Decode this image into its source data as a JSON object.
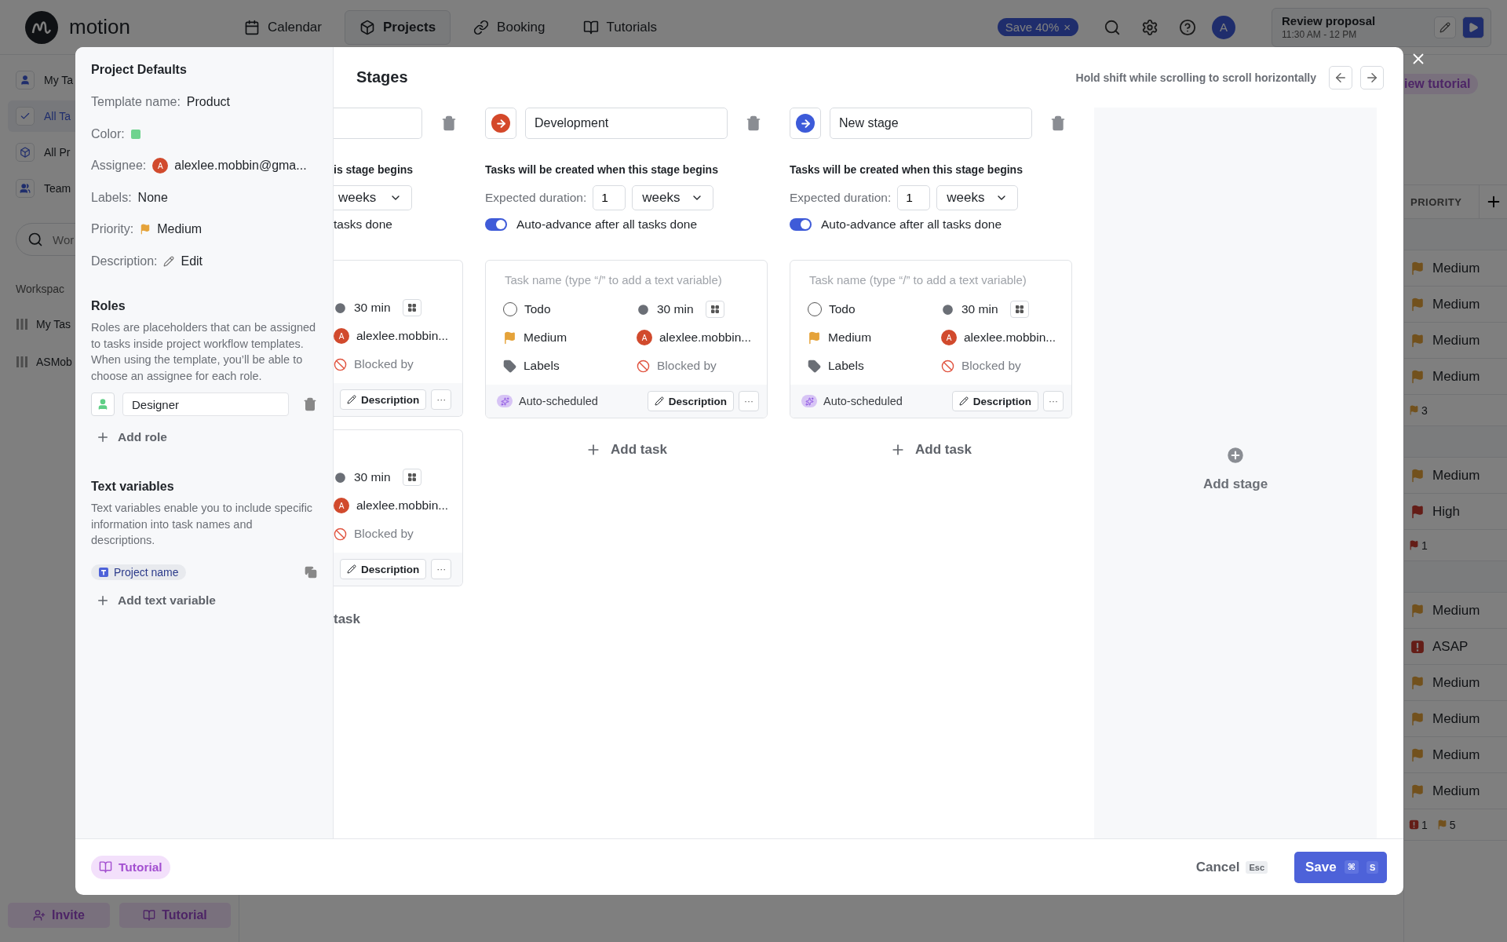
{
  "app": {
    "brand": "motion",
    "nav": [
      {
        "label": "Calendar",
        "selected": false
      },
      {
        "label": "Projects",
        "selected": true
      },
      {
        "label": "Booking",
        "selected": false
      },
      {
        "label": "Tutorials",
        "selected": false
      }
    ],
    "promo": "Save 40%",
    "promo_close": "×",
    "avatar": "A",
    "event": {
      "title": "Review proposal",
      "time": "11:30 AM - 12 PM"
    },
    "sidebar": {
      "items": [
        {
          "label": "My Ta",
          "selected": false
        },
        {
          "label": "All Ta",
          "selected": true
        },
        {
          "label": "All Pr",
          "selected": false
        },
        {
          "label": "Team",
          "selected": false
        }
      ],
      "search_placeholder": "Wor",
      "section": "Workspac",
      "projects": [
        "My Tas",
        "ASMob"
      ],
      "bottom_buttons": [
        "Invite",
        "Tutorial"
      ]
    },
    "right": {
      "pill": "iew tutorial",
      "column_header": "PRIORITY",
      "groups": [
        {
          "rows": [
            {
              "kind": "medium",
              "label": "Medium"
            },
            {
              "kind": "medium",
              "label": "Medium"
            },
            {
              "kind": "medium",
              "label": "Medium"
            },
            {
              "kind": "medium",
              "label": "Medium"
            }
          ],
          "summary": [
            {
              "kind": "medium",
              "count": "3"
            }
          ]
        },
        {
          "rows": [
            {
              "kind": "medium",
              "label": "Medium"
            },
            {
              "kind": "high",
              "label": "High"
            }
          ],
          "summary": [
            {
              "kind": "high",
              "count": "1"
            }
          ]
        },
        {
          "rows": [
            {
              "kind": "medium",
              "label": "Medium"
            },
            {
              "kind": "asap",
              "label": "ASAP"
            },
            {
              "kind": "medium",
              "label": "Medium"
            },
            {
              "kind": "medium",
              "label": "Medium"
            },
            {
              "kind": "medium",
              "label": "Medium"
            },
            {
              "kind": "medium",
              "label": "Medium"
            }
          ],
          "summary": [
            {
              "kind": "asap",
              "count": "1"
            },
            {
              "kind": "medium",
              "count": "5"
            }
          ]
        }
      ]
    }
  },
  "modal": {
    "defaults": {
      "title": "Project Defaults",
      "fields": [
        {
          "kind": "text",
          "label": "Template name:",
          "value": "Product"
        },
        {
          "kind": "color",
          "label": "Color:",
          "color": "#6fd38f"
        },
        {
          "kind": "assignee",
          "label": "Assignee:",
          "initial": "A",
          "value": "alexlee.mobbin@gma..."
        },
        {
          "kind": "text",
          "label": "Labels:",
          "value": "None"
        },
        {
          "kind": "priority",
          "label": "Priority:",
          "value": "Medium"
        },
        {
          "kind": "edit",
          "label": "Description:",
          "value": "Edit"
        }
      ]
    },
    "roles": {
      "title": "Roles",
      "description": "Roles are placeholders that can be assigned to tasks inside project workflow templates. When using the template, you’ll be able to choose an assignee for each role.",
      "items": [
        {
          "name": "Designer"
        }
      ],
      "add": "Add role"
    },
    "text_variables": {
      "title": "Text variables",
      "description": "Text variables enable you to include specific information into task names and descriptions.",
      "items": [
        {
          "name": "Project name"
        }
      ],
      "add": "Add text variable"
    },
    "tutorial": "Tutorial",
    "stages": {
      "title": "Stages",
      "hint": "Hold shift while scrolling to scroll horizontally",
      "columns": [
        {
          "kind": "partial",
          "note": "is stage begins",
          "unit": "weeks",
          "auto_label": "tasks done",
          "tasks": [
            {
              "duration": "30 min",
              "initial": "A",
              "assignee": "alexlee.mobbin...",
              "blocked": "Blocked by",
              "description": "Description",
              "more": "···"
            },
            {
              "duration": "30 min",
              "initial": "A",
              "assignee": "alexlee.mobbin...",
              "blocked": "Blocked by",
              "description": "Description",
              "more": "···"
            }
          ],
          "add_task": "task"
        },
        {
          "kind": "full",
          "color": "#d4482a",
          "name": "Development",
          "note": "Tasks will be created when this stage begins",
          "duration_label": "Expected duration:",
          "duration": "1",
          "unit": "weeks",
          "auto_on": true,
          "auto_label": "Auto-advance after all tasks done",
          "tasks": [
            {
              "placeholder": "Task name (type “/” to add a text variable)",
              "status": "Todo",
              "duration": "30 min",
              "priority": "Medium",
              "initial": "A",
              "assignee": "alexlee.mobbin...",
              "labels": "Labels",
              "blocked": "Blocked by",
              "scheduling": "Auto-scheduled",
              "description": "Description",
              "more": "···"
            }
          ],
          "add_task": "Add task"
        },
        {
          "kind": "full",
          "color": "#3d5bd9",
          "name": "New stage",
          "note": "Tasks will be created when this stage begins",
          "duration_label": "Expected duration:",
          "duration": "1",
          "unit": "weeks",
          "auto_on": true,
          "auto_label": "Auto-advance after all tasks done",
          "tasks": [
            {
              "placeholder": "Task name (type “/” to add a text variable)",
              "status": "Todo",
              "duration": "30 min",
              "priority": "Medium",
              "initial": "A",
              "assignee": "alexlee.mobbin...",
              "labels": "Labels",
              "blocked": "Blocked by",
              "scheduling": "Auto-scheduled",
              "description": "Description",
              "more": "···"
            }
          ],
          "add_task": "Add task"
        }
      ],
      "add_stage": "Add stage"
    },
    "cancel": "Cancel",
    "cancel_key": "Esc",
    "save": "Save",
    "save_keys": [
      "⌘",
      "S"
    ]
  }
}
